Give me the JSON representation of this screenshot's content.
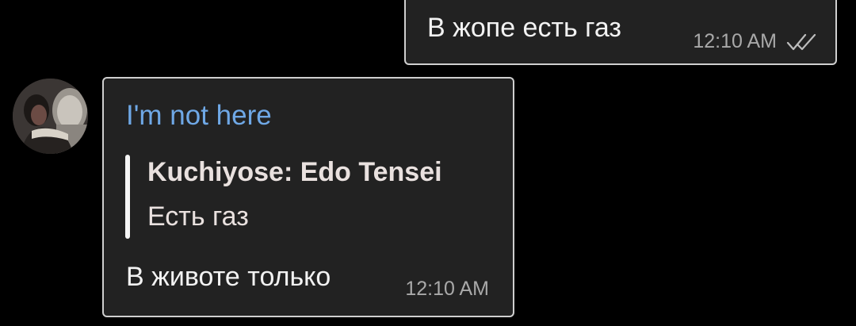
{
  "messages": [
    {
      "direction": "outgoing",
      "text": "В жопе есть газ",
      "time": "12:10 AM",
      "status_icon": "double-check-icon"
    },
    {
      "direction": "incoming",
      "sender": "I'm not here",
      "reply": {
        "author": "Kuchiyose: Edo Tensei",
        "text": "Есть газ"
      },
      "text": "В животе только",
      "time": "12:10 AM",
      "avatar_icon": "avatar-photo"
    }
  ],
  "colors": {
    "background": "#000000",
    "bubble": "#222222",
    "bubble_border": "#cfcfcf",
    "sender_name": "#6fa8e6",
    "reply_bar": "#f5f5f5",
    "time": "#a9a9a9",
    "text": "#f2f2f2"
  }
}
